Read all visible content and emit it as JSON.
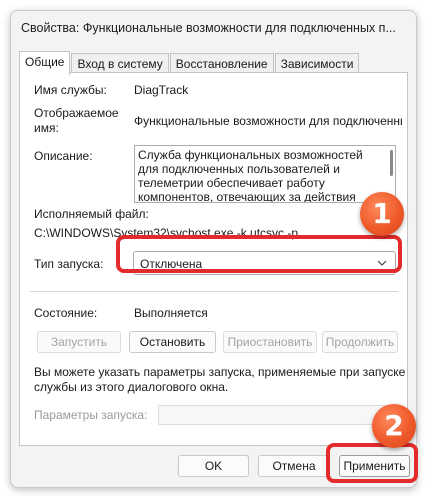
{
  "window": {
    "title": "Свойства: Функциональные возможности для подключенных п..."
  },
  "tabs": [
    {
      "label": "Общие",
      "active": true
    },
    {
      "label": "Вход в систему",
      "active": false
    },
    {
      "label": "Восстановление",
      "active": false
    },
    {
      "label": "Зависимости",
      "active": false
    }
  ],
  "general": {
    "service_name_label": "Имя службы:",
    "service_name_value": "DiagTrack",
    "display_name_label_1": "Отображаемое",
    "display_name_label_2": "имя:",
    "display_name_value": "Функциональные возможности для подключенных г",
    "description_label": "Описание:",
    "description_value": "Служба функциональных возможностей для подключенных пользователей и телеметрии обеспечивает работу компонентов, отвечающих за действия подключенных пользователей",
    "exe_label": "Исполняемый файл:",
    "exe_value": "C:\\WINDOWS\\System32\\svchost.exe -k utcsvc -p",
    "startup_type_label": "Тип запуска:",
    "startup_type_value": "Отключена",
    "status_label": "Состояние:",
    "status_value": "Выполняется",
    "btn_start": "Запустить",
    "btn_stop": "Остановить",
    "btn_pause": "Приостановить",
    "btn_resume": "Продолжить",
    "hint_line1": "Вы можете указать параметры запуска, применяемые при запуске",
    "hint_line2": "службы из этого диалогового окна.",
    "params_label": "Параметры запуска:"
  },
  "footer": {
    "ok": "OK",
    "cancel": "Отмена",
    "apply": "Применить"
  },
  "annotations": {
    "badge1": "1",
    "badge2": "2",
    "highlight_color": "#e32b2b",
    "badge_color": "#ef5a2a"
  }
}
